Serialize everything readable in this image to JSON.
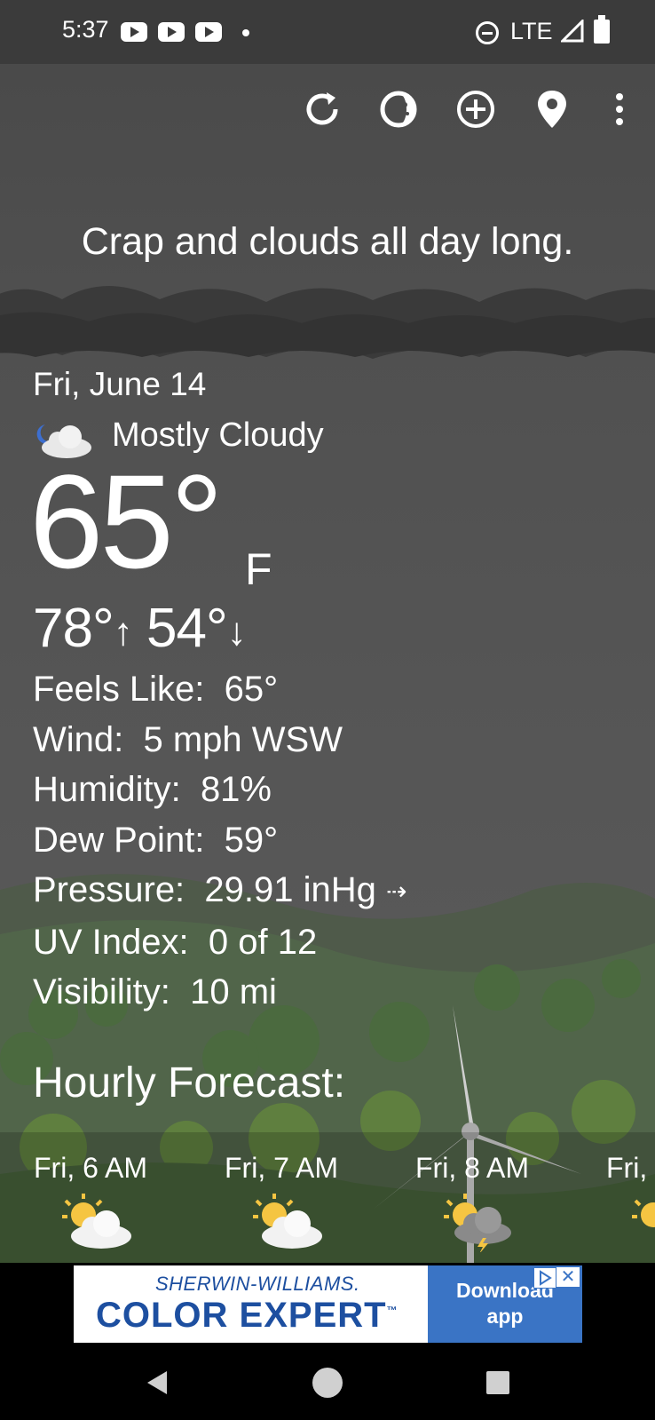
{
  "status_bar": {
    "time": "5:37",
    "notification_icons": [
      "youtube-icon",
      "youtube-icon",
      "youtube-icon"
    ],
    "network": "LTE",
    "system_icons": [
      "do-not-disturb-icon",
      "signal-icon",
      "battery-icon"
    ]
  },
  "toolbar": {
    "icons": [
      "refresh-icon",
      "theme-icon",
      "add-location-icon",
      "location-pin-icon",
      "more-vert-icon"
    ]
  },
  "tagline": "Crap and clouds all day long.",
  "current": {
    "date": "Fri, June 14",
    "condition": "Mostly Cloudy",
    "condition_icon": "moon-cloud-icon",
    "temp": "65°",
    "unit": "F",
    "high": "78°",
    "low": "54°"
  },
  "details": [
    {
      "label": "Feels Like:",
      "value": "65°"
    },
    {
      "label": "Wind:",
      "value": "5 mph WSW"
    },
    {
      "label": "Humidity:",
      "value": "81%"
    },
    {
      "label": "Dew Point:",
      "value": "59°"
    },
    {
      "label": "Pressure:",
      "value": "29.91 inHg",
      "trend": "⇢"
    },
    {
      "label": "UV Index:",
      "value": "0 of 12"
    },
    {
      "label": "Visibility:",
      "value": "10 mi"
    }
  ],
  "hourly": {
    "title": "Hourly Forecast:",
    "items": [
      {
        "time": "Fri, 6 AM",
        "icon": "partly-sunny-icon"
      },
      {
        "time": "Fri, 7 AM",
        "icon": "partly-sunny-icon"
      },
      {
        "time": "Fri, 8 AM",
        "icon": "sun-storm-icon"
      },
      {
        "time": "Fri,",
        "icon": "partly-sunny-icon"
      }
    ]
  },
  "ad": {
    "brand": "SHERWIN-WILLIAMS.",
    "product": "COLOR EXPERT",
    "trademark": "™",
    "cta_line1": "Download",
    "cta_line2": "app",
    "close": "✕"
  },
  "colors": {
    "status_bar": "#3b3b3b",
    "sky": "#555555",
    "ad_blue": "#1d4fa0",
    "ad_button": "#3a74c5"
  }
}
